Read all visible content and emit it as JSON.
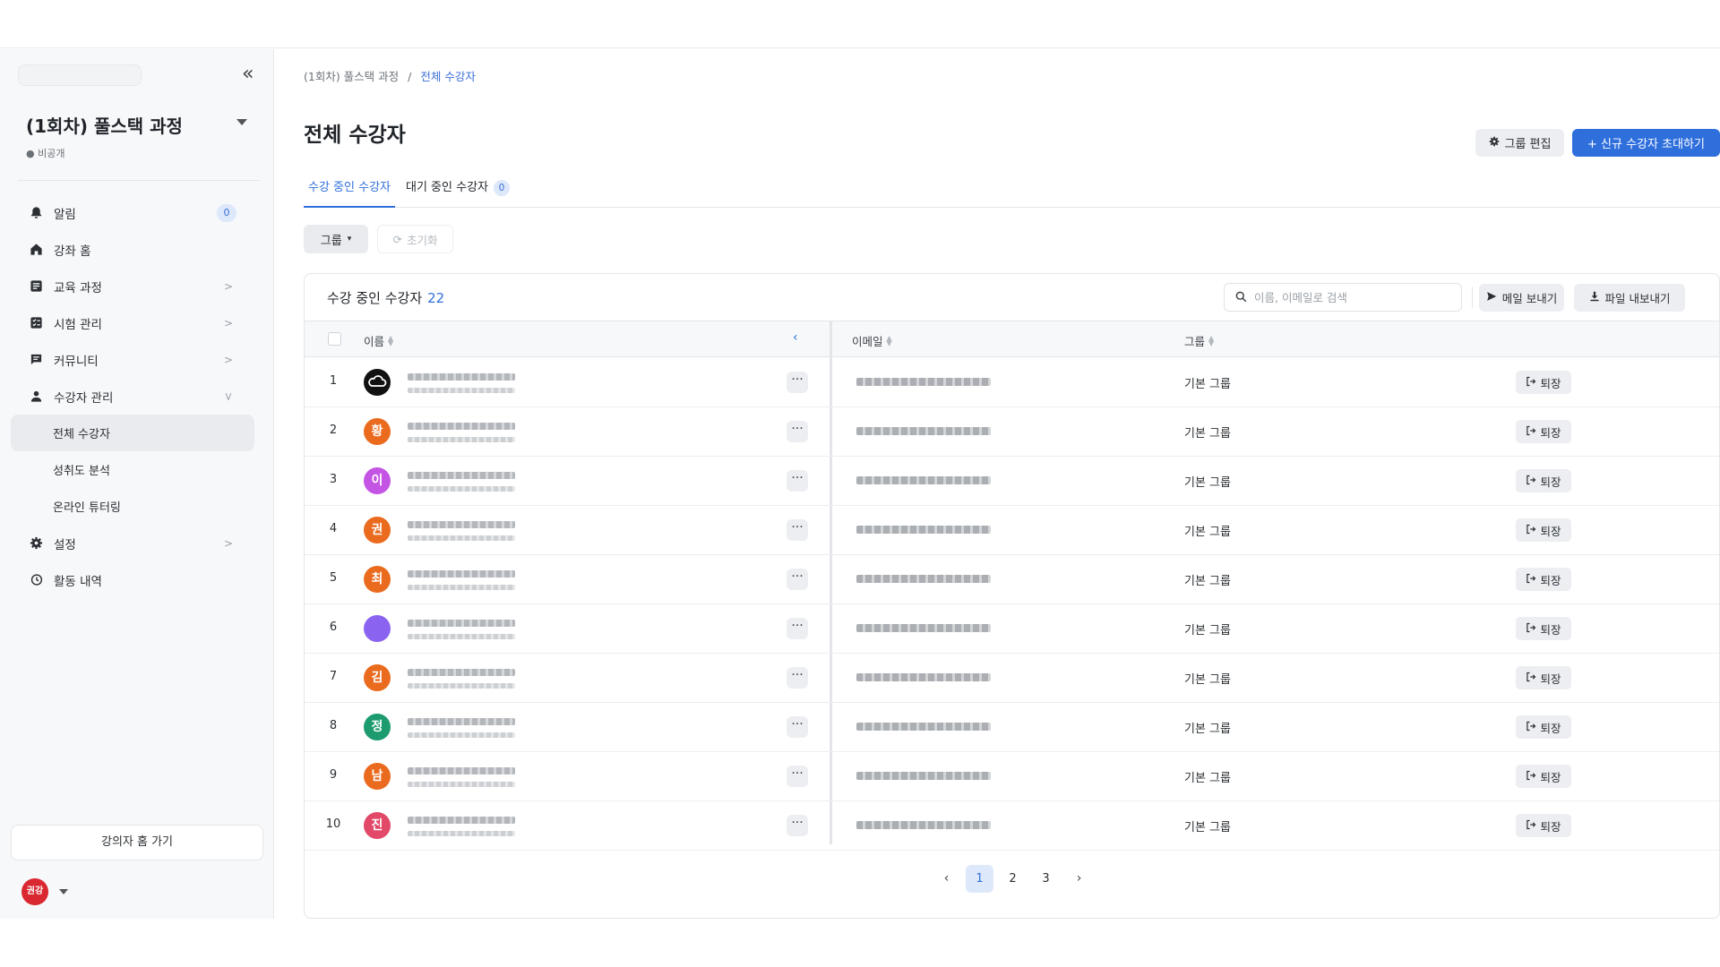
{
  "sidebar": {
    "course_title": "(1회차) 풀스택 과정",
    "course_status": "● 비공개",
    "nav": [
      {
        "label": "알림",
        "icon": "bell-icon",
        "badge": "0"
      },
      {
        "label": "강좌 홈",
        "icon": "home-icon"
      },
      {
        "label": "교육 과정",
        "icon": "curriculum-icon"
      },
      {
        "label": "시험 관리",
        "icon": "exam-icon"
      },
      {
        "label": "커뮤니티",
        "icon": "chat-icon"
      },
      {
        "label": "수강자 관리",
        "icon": "person-icon"
      }
    ],
    "sub": [
      "전체 수강자",
      "성취도 분석",
      "온라인 튜터링"
    ],
    "nav2": [
      {
        "label": "설정",
        "icon": "gear-icon"
      },
      {
        "label": "활동 내역",
        "icon": "history-icon"
      }
    ],
    "home_button": "강의자 홈 가기",
    "avatar_text": "권강"
  },
  "breadcrumb": {
    "parent": "(1회차) 풀스택 과정",
    "sep": "/",
    "current": "전체 수강자"
  },
  "header": {
    "title": "전체 수강자",
    "group_edit": "그룹 편집",
    "invite": "+ 신규 수강자 초대하기"
  },
  "tabs": [
    {
      "label": "수강 중인 수강자"
    },
    {
      "label": "대기 중인 수강자",
      "badge": "0"
    }
  ],
  "filters": {
    "group": "그룹",
    "reset": "초기화"
  },
  "table": {
    "title": "수강 중인 수강자",
    "count": "22",
    "search_placeholder": "이름, 이메일로 검색",
    "mail_button": "메일 보내기",
    "export_button": "파일 내보내기",
    "columns": {
      "name": "이름",
      "email": "이메일",
      "group": "그룹"
    },
    "leave_label": "퇴장",
    "rows": [
      {
        "num": "1",
        "avatar": "",
        "avatar_color": "#111111",
        "group": "기본 그룹"
      },
      {
        "num": "2",
        "avatar": "황",
        "avatar_color": "#ea6a1e",
        "group": "기본 그룹"
      },
      {
        "num": "3",
        "avatar": "이",
        "avatar_color": "#c454e3",
        "group": "기본 그룹"
      },
      {
        "num": "4",
        "avatar": "권",
        "avatar_color": "#ea6a1e",
        "group": "기본 그룹"
      },
      {
        "num": "5",
        "avatar": "최",
        "avatar_color": "#ea6a1e",
        "group": "기본 그룹"
      },
      {
        "num": "6",
        "avatar": "",
        "avatar_color": "#8a63f0",
        "group": "기본 그룹"
      },
      {
        "num": "7",
        "avatar": "김",
        "avatar_color": "#ea6a1e",
        "group": "기본 그룹"
      },
      {
        "num": "8",
        "avatar": "정",
        "avatar_color": "#1c9b6f",
        "group": "기본 그룹"
      },
      {
        "num": "9",
        "avatar": "남",
        "avatar_color": "#ea6a1e",
        "group": "기본 그룹"
      },
      {
        "num": "10",
        "avatar": "진",
        "avatar_color": "#e24868",
        "group": "기본 그룹"
      }
    ]
  },
  "pagination": {
    "pages": [
      "1",
      "2",
      "3"
    ],
    "current": "1"
  }
}
